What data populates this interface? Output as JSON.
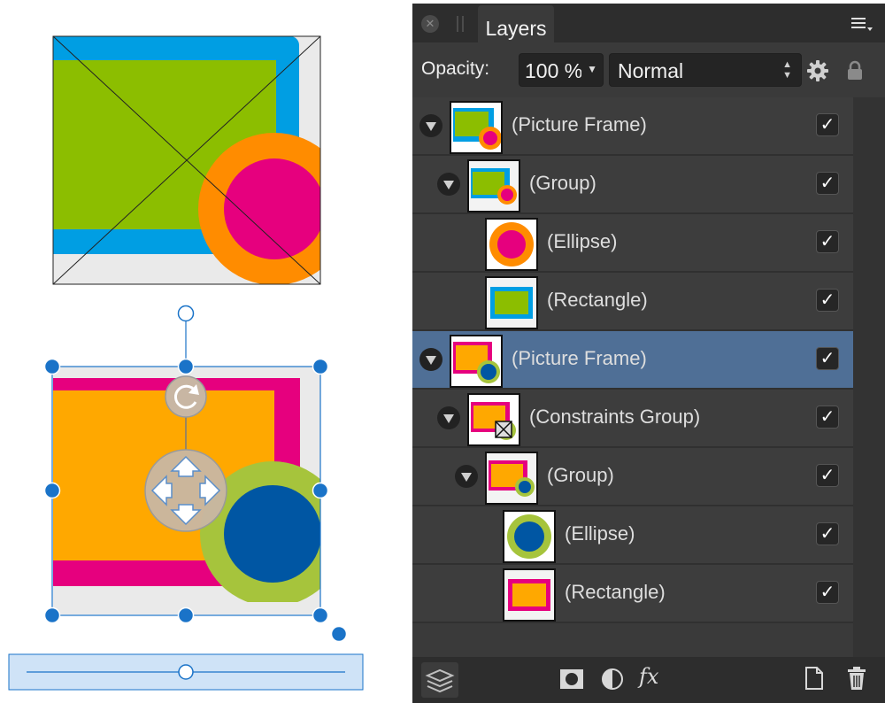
{
  "layers_panel": {
    "tab_label": "Layers",
    "close_icon": "close-icon",
    "menu_icon": "panel-menu-icon",
    "opacity_label": "Opacity:",
    "opacity_value": "100 %",
    "blend_mode": "Normal",
    "blend_options": [
      "Normal"
    ],
    "selected_color": "#4f6f96",
    "layers": [
      {
        "label": "(Picture Frame)",
        "depth": 0,
        "expandable": true,
        "selected": false,
        "visible": true,
        "thumb": "frame-green"
      },
      {
        "label": "(Group)",
        "depth": 1,
        "expandable": true,
        "selected": false,
        "visible": true,
        "thumb": "group-green"
      },
      {
        "label": "(Ellipse)",
        "depth": 2,
        "expandable": false,
        "selected": false,
        "visible": true,
        "thumb": "ellipse-pink"
      },
      {
        "label": "(Rectangle)",
        "depth": 2,
        "expandable": false,
        "selected": false,
        "visible": true,
        "thumb": "rect-green"
      },
      {
        "label": "(Picture Frame)",
        "depth": 0,
        "expandable": true,
        "selected": true,
        "visible": true,
        "thumb": "frame-orange"
      },
      {
        "label": "(Constraints Group)",
        "depth": 1,
        "expandable": true,
        "selected": false,
        "visible": true,
        "thumb": "constraints"
      },
      {
        "label": "(Group)",
        "depth": 2,
        "expandable": true,
        "selected": false,
        "visible": true,
        "thumb": "group-orange"
      },
      {
        "label": "(Ellipse)",
        "depth": 3,
        "expandable": false,
        "selected": false,
        "visible": true,
        "thumb": "ellipse-blue"
      },
      {
        "label": "(Rectangle)",
        "depth": 3,
        "expandable": false,
        "selected": false,
        "visible": true,
        "thumb": "rect-orange"
      }
    ],
    "bottom_tools": [
      "layers-stack-icon",
      "mask-icon",
      "adjustment-icon",
      "fx-icon",
      "new-layer-icon",
      "trash-icon"
    ],
    "fx_label": "fx"
  },
  "canvas": {
    "frame1": {
      "rect_fill": "#8cbe00",
      "rect_stroke": "#009ee3",
      "circle_outer": "#ff8c00",
      "circle_inner": "#e6007e"
    },
    "frame2": {
      "rect_fill": "#ffa800",
      "rect_stroke": "#e6007e",
      "circle_outer": "#a6c43c",
      "circle_inner": "#0056a3"
    },
    "selection_color": "#1a73c8",
    "rotation_percent": 50
  }
}
